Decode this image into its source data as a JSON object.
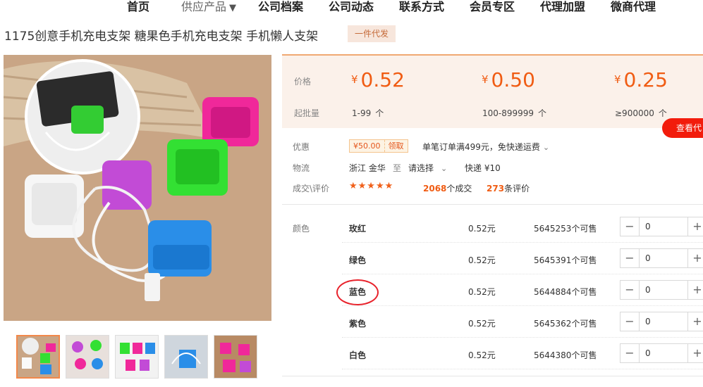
{
  "nav": [
    "首页",
    "供应产品",
    "公司档案",
    "公司动态",
    "联系方式",
    "会员专区",
    "代理加盟",
    "微商代理"
  ],
  "nav_caret": "▼",
  "product": {
    "title": "1175创意手机充电支架 糖果色手机充电支架 手机懒人支架",
    "badge": "一件代发"
  },
  "price_box": {
    "price_label": "价格",
    "qty_label": "起批量",
    "currency": "¥",
    "tiers": [
      {
        "price": "0.52",
        "range": "1-99",
        "unit": "个"
      },
      {
        "price": "0.50",
        "range": "100-899999",
        "unit": "个"
      },
      {
        "price": "0.25",
        "range": "≥900000",
        "unit": "个"
      }
    ],
    "view_button": "查看代"
  },
  "info": {
    "discount_label": "优惠",
    "coupon_amount": "¥50.00",
    "coupon_get": "领取",
    "free_shipping": "单笔订单满499元，免快递运费",
    "logistics_label": "物流",
    "origin": "浙江 金华",
    "to": "至",
    "destination": "请选择",
    "shipping": "快递 ¥10",
    "deal_label": "成交\\评价",
    "stars": "★★★★★",
    "deals_count": "2068",
    "deals_text": "个成交",
    "reviews_count": "273",
    "reviews_text": "条评价"
  },
  "sku": {
    "label": "颜色",
    "rows": [
      {
        "name": "玫红",
        "price": "0.52元",
        "stock": "5645253个可售",
        "qty": "0"
      },
      {
        "name": "绿色",
        "price": "0.52元",
        "stock": "5645391个可售",
        "qty": "0"
      },
      {
        "name": "蓝色",
        "price": "0.52元",
        "stock": "5644884个可售",
        "qty": "0"
      },
      {
        "name": "紫色",
        "price": "0.52元",
        "stock": "5645362个可售",
        "qty": "0"
      },
      {
        "name": "白色",
        "price": "0.52元",
        "stock": "5644380个可售",
        "qty": "0"
      }
    ],
    "minus": "−",
    "plus": "+"
  },
  "colors": {
    "accent": "#f05c13",
    "button_red": "#f21c0c",
    "annotation_circle": "#e8232c"
  }
}
